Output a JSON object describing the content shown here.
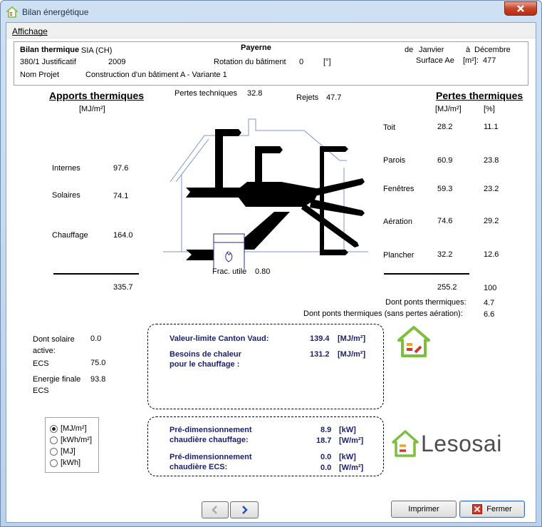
{
  "window": {
    "title": "Bilan énergétique"
  },
  "menu": {
    "affichage": "Affichage"
  },
  "header": {
    "bilan_label": "Bilan thermique",
    "standard": "SIA (CH)",
    "location": "Payerne",
    "period_from_label": "de",
    "period_from": "Janvier",
    "period_to_label": "à",
    "period_to": "Décembre",
    "justificatif": "380/1 Justificatif",
    "year": "2009",
    "rotation_label": "Rotation du bâtiment",
    "rotation_value": "0",
    "rotation_unit": "[°]",
    "surface_label": "Surface Ae",
    "surface_unit": "[m²]:",
    "surface_value": "477",
    "projet_label": "Nom Projet",
    "projet_value": "Construction d'un bâtiment A - Variante 1"
  },
  "apports": {
    "title": "Apports thermiques",
    "unit": "[MJ/m²]",
    "rows": [
      {
        "label": "Internes",
        "value": "97.6"
      },
      {
        "label": "Solaires",
        "value": "74.1"
      },
      {
        "label": "Chauffage",
        "value": "164.0"
      }
    ],
    "total": "335.7"
  },
  "diagram": {
    "pertes_tech_label": "Pertes techniques",
    "pertes_tech_value": "32.8",
    "rejets_label": "Rejets",
    "rejets_value": "47.7",
    "frac_label": "Frac. utile",
    "frac_value": "0.80"
  },
  "pertes": {
    "title": "Pertes thermiques",
    "unit1": "[MJ/m²]",
    "unit2": "[%]",
    "rows": [
      {
        "label": "Toit",
        "value": "28.2",
        "pct": "11.1"
      },
      {
        "label": "Parois",
        "value": "60.9",
        "pct": "23.8"
      },
      {
        "label": "Fenêtres",
        "value": "59.3",
        "pct": "23.2"
      },
      {
        "label": "Aération",
        "value": "74.6",
        "pct": "29.2"
      },
      {
        "label": "Plancher",
        "value": "32.2",
        "pct": "12.6"
      }
    ],
    "total": "255.2",
    "total_pct": "100",
    "ponts_label": "Dont ponts thermiques:",
    "ponts_value": "4.7",
    "ponts_sans_label": "Dont ponts thermiques (sans pertes aération):",
    "ponts_sans_value": "6.6"
  },
  "left_info": {
    "solaire_label_1": "Dont solaire",
    "solaire_label_2": "active:",
    "solaire_value": "0.0",
    "ecs_label": "ECS",
    "ecs_value": "75.0",
    "energie_label_1": "Energie finale",
    "energie_label_2": "ECS",
    "energie_value": "93.8"
  },
  "box1": {
    "limite_label": "Valeur-limite Canton Vaud:",
    "limite_value": "139.4",
    "limite_unit": "[MJ/m²]",
    "besoins_label_1": "Besoins de chaleur",
    "besoins_label_2": "pour le chauffage :",
    "besoins_value": "131.2",
    "besoins_unit": "[MJ/m²]"
  },
  "box2": {
    "pre_chauff_label_1": "Pré-dimensionnement",
    "pre_chauff_label_2": "chaudière chauffage:",
    "pre_chauff_kw": "8.9",
    "pre_chauff_kw_unit": "[kW]",
    "pre_chauff_wm2": "18.7",
    "pre_chauff_wm2_unit": "[W/m²]",
    "pre_ecs_label_1": "Pré-dimensionnement",
    "pre_ecs_label_2": "chaudière ECS:",
    "pre_ecs_kw": "0.0",
    "pre_ecs_kw_unit": "[kW]",
    "pre_ecs_wm2": "0.0",
    "pre_ecs_wm2_unit": "[W/m²]"
  },
  "units_radio": {
    "options": [
      "[MJ/m²]",
      "[kWh/m²]",
      "[MJ]",
      "[kWh]"
    ],
    "selected": "[MJ/m²]"
  },
  "logo": {
    "text": "Lesosai"
  },
  "buttons": {
    "imprimer": "Imprimer",
    "fermer": "Fermer"
  },
  "colors": {
    "accent_navy": "#1a1f6e",
    "logo_green": "#7cbf3a",
    "logo_red": "#d13a2a",
    "logo_orange": "#f2a31d"
  }
}
